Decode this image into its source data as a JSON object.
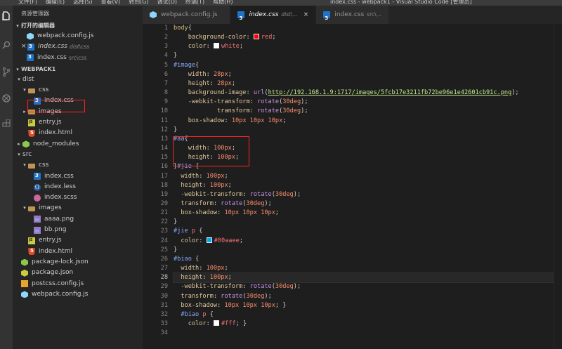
{
  "window": {
    "menu": [
      "文件(F)",
      "编辑(E)",
      "选择(S)",
      "查看(V)",
      "转到(G)",
      "调试(D)",
      "终端(T)",
      "帮助(H)"
    ],
    "title": "index.css - webpack1 - Visual Studio Code [管理员]"
  },
  "sidebar": {
    "title": "资源管理器",
    "open_editors_label": "打开的编辑器",
    "open_editors": [
      {
        "name": "webpack.config.js",
        "desc": "",
        "icon": "webpack-icon"
      },
      {
        "name": "index.css",
        "desc": "dist\\css",
        "icon": "css-icon",
        "close": "×"
      },
      {
        "name": "index.css",
        "desc": "src\\css",
        "icon": "css-icon"
      }
    ],
    "project_label": "WEBPACK1",
    "tree": [
      {
        "name": "dist",
        "arrow": "▾"
      },
      {
        "name": "css",
        "arrow": "▾"
      },
      {
        "name": "index.css"
      },
      {
        "name": "images",
        "arrow": "▸"
      },
      {
        "name": "entry.js"
      },
      {
        "name": "index.html"
      },
      {
        "name": "node_modules",
        "arrow": "▸"
      },
      {
        "name": "src",
        "arrow": "▾"
      },
      {
        "name": "css",
        "arrow": "▾"
      },
      {
        "name": "index.css"
      },
      {
        "name": "index.less"
      },
      {
        "name": "index.scss"
      },
      {
        "name": "images",
        "arrow": "▾"
      },
      {
        "name": "aaaa.png"
      },
      {
        "name": "bb.png"
      },
      {
        "name": "entry.js"
      },
      {
        "name": "index.html"
      },
      {
        "name": "package-lock.json"
      },
      {
        "name": "package.json"
      },
      {
        "name": "postcss.config.js"
      },
      {
        "name": "webpack.config.js"
      }
    ]
  },
  "tabs": [
    {
      "label": "webpack.config.js",
      "desc": "",
      "close": ""
    },
    {
      "label": "index.css",
      "desc": "dist\\...",
      "close": "×"
    },
    {
      "label": "index.css",
      "desc": "src\\..."
    }
  ],
  "editor": {
    "current_line": 28,
    "colors": {
      "red_swatch": "#ff0000",
      "white_swatch": "#ffffff",
      "teal_swatch": "#00aaee",
      "fff_swatch": "#ffffff"
    },
    "lines": [
      {
        "n": "1",
        "t": [
          [
            "t-sel",
            "body"
          ],
          [
            "t-punc",
            "{"
          ]
        ]
      },
      {
        "n": "2",
        "t": [
          [
            "t-punc",
            "    "
          ],
          [
            "t-prop",
            "background-color"
          ],
          [
            "t-punc",
            ": "
          ],
          [
            "sw",
            "#ff0000"
          ],
          [
            "t-val",
            "red"
          ],
          [
            "t-punc",
            ";"
          ]
        ]
      },
      {
        "n": "3",
        "t": [
          [
            "t-punc",
            "    "
          ],
          [
            "t-prop",
            "color"
          ],
          [
            "t-punc",
            ": "
          ],
          [
            "sw",
            "#ffffff"
          ],
          [
            "t-val",
            "white"
          ],
          [
            "t-punc",
            ";"
          ]
        ]
      },
      {
        "n": "4",
        "t": [
          [
            "t-punc",
            "}"
          ]
        ]
      },
      {
        "n": "5",
        "t": [
          [
            "sel-id",
            "#image"
          ],
          [
            "t-punc",
            "{"
          ]
        ]
      },
      {
        "n": "6",
        "t": [
          [
            "t-punc",
            "    "
          ],
          [
            "t-prop",
            "width"
          ],
          [
            "t-punc",
            ": "
          ],
          [
            "t-num",
            "28px"
          ],
          [
            "t-punc",
            ";"
          ]
        ]
      },
      {
        "n": "7",
        "t": [
          [
            "t-punc",
            "    "
          ],
          [
            "t-prop",
            "height"
          ],
          [
            "t-punc",
            ": "
          ],
          [
            "t-num",
            "28px"
          ],
          [
            "t-punc",
            ";"
          ]
        ]
      },
      {
        "n": "8",
        "t": [
          [
            "t-punc",
            "    "
          ],
          [
            "t-prop",
            "background-image"
          ],
          [
            "t-punc",
            ": "
          ],
          [
            "t-fn",
            "url"
          ],
          [
            "t-punc",
            "("
          ],
          [
            "t-url",
            "http://192.168.1.9:1717/images/5fcb17e3211fb72be96e1e42601cb91c.png"
          ],
          [
            "t-punc",
            ");"
          ]
        ]
      },
      {
        "n": "9",
        "t": [
          [
            "t-punc",
            "    "
          ],
          [
            "t-prop",
            "-webkit-transform"
          ],
          [
            "t-punc",
            ": "
          ],
          [
            "t-fn",
            "rotate"
          ],
          [
            "t-punc",
            "("
          ],
          [
            "t-num",
            "30deg"
          ],
          [
            "t-punc",
            ");"
          ]
        ]
      },
      {
        "n": "10",
        "t": [
          [
            "t-punc",
            "            "
          ],
          [
            "t-prop",
            "transform"
          ],
          [
            "t-punc",
            ": "
          ],
          [
            "t-fn",
            "rotate"
          ],
          [
            "t-punc",
            "("
          ],
          [
            "t-num",
            "30deg"
          ],
          [
            "t-punc",
            ");"
          ]
        ]
      },
      {
        "n": "11",
        "t": [
          [
            "t-punc",
            "    "
          ],
          [
            "t-prop",
            "box-shadow"
          ],
          [
            "t-punc",
            ": "
          ],
          [
            "t-num",
            "10px 10px 10px"
          ],
          [
            "t-punc",
            ";"
          ]
        ]
      },
      {
        "n": "12",
        "t": [
          [
            "t-punc",
            "}"
          ]
        ]
      },
      {
        "n": "13",
        "t": [
          [
            "sel-id",
            "#aa"
          ],
          [
            "t-punc",
            "{"
          ]
        ]
      },
      {
        "n": "14",
        "t": [
          [
            "t-punc",
            "    "
          ],
          [
            "t-prop",
            "width"
          ],
          [
            "t-punc",
            ": "
          ],
          [
            "t-num",
            "100px"
          ],
          [
            "t-punc",
            ";"
          ]
        ]
      },
      {
        "n": "15",
        "t": [
          [
            "t-punc",
            "    "
          ],
          [
            "t-prop",
            "height"
          ],
          [
            "t-punc",
            ": "
          ],
          [
            "t-num",
            "100px"
          ],
          [
            "t-punc",
            ";"
          ]
        ]
      },
      {
        "n": "16",
        "t": [
          [
            "t-punc",
            "}"
          ],
          [
            "sel-id",
            "#jie"
          ],
          [
            "t-punc",
            " {"
          ]
        ]
      },
      {
        "n": "17",
        "t": [
          [
            "t-punc",
            "  "
          ],
          [
            "t-prop",
            "width"
          ],
          [
            "t-punc",
            ": "
          ],
          [
            "t-num",
            "100px"
          ],
          [
            "t-punc",
            ";"
          ]
        ]
      },
      {
        "n": "18",
        "t": [
          [
            "t-punc",
            "  "
          ],
          [
            "t-prop",
            "height"
          ],
          [
            "t-punc",
            ": "
          ],
          [
            "t-num",
            "100px"
          ],
          [
            "t-punc",
            ";"
          ]
        ]
      },
      {
        "n": "19",
        "t": [
          [
            "t-punc",
            "  "
          ],
          [
            "t-prop",
            "-webkit-transform"
          ],
          [
            "t-punc",
            ": "
          ],
          [
            "t-fn",
            "rotate"
          ],
          [
            "t-punc",
            "("
          ],
          [
            "t-num",
            "30deg"
          ],
          [
            "t-punc",
            ");"
          ]
        ]
      },
      {
        "n": "20",
        "t": [
          [
            "t-punc",
            "  "
          ],
          [
            "t-prop",
            "transform"
          ],
          [
            "t-punc",
            ": "
          ],
          [
            "t-fn",
            "rotate"
          ],
          [
            "t-punc",
            "("
          ],
          [
            "t-num",
            "30deg"
          ],
          [
            "t-punc",
            ");"
          ]
        ]
      },
      {
        "n": "21",
        "t": [
          [
            "t-punc",
            "  "
          ],
          [
            "t-prop",
            "box-shadow"
          ],
          [
            "t-punc",
            ": "
          ],
          [
            "t-num",
            "10px 10px 10px"
          ],
          [
            "t-punc",
            ";"
          ]
        ]
      },
      {
        "n": "22",
        "t": [
          [
            "t-punc",
            "}"
          ]
        ]
      },
      {
        "n": "23",
        "t": [
          [
            "sel-id",
            "#jie"
          ],
          [
            "t-punc",
            " "
          ],
          [
            "t-tag",
            "p"
          ],
          [
            "t-punc",
            " {"
          ]
        ]
      },
      {
        "n": "24",
        "t": [
          [
            "t-punc",
            "  "
          ],
          [
            "t-prop",
            "color"
          ],
          [
            "t-punc",
            ": "
          ],
          [
            "sw",
            "#00aaee"
          ],
          [
            "t-val",
            "#00aaee"
          ],
          [
            "t-punc",
            ";"
          ]
        ]
      },
      {
        "n": "25",
        "t": [
          [
            "t-punc",
            "}"
          ]
        ]
      },
      {
        "n": "26",
        "t": [
          [
            "sel-id",
            "#biao"
          ],
          [
            "t-punc",
            " {"
          ]
        ]
      },
      {
        "n": "27",
        "t": [
          [
            "t-punc",
            "  "
          ],
          [
            "t-prop",
            "width"
          ],
          [
            "t-punc",
            ": "
          ],
          [
            "t-num",
            "100px"
          ],
          [
            "t-punc",
            ";"
          ]
        ]
      },
      {
        "n": "28",
        "t": [
          [
            "t-punc",
            "  "
          ],
          [
            "t-prop",
            "height"
          ],
          [
            "t-punc",
            ": "
          ],
          [
            "t-num",
            "100px"
          ],
          [
            "t-punc",
            ";"
          ]
        ]
      },
      {
        "n": "29",
        "t": [
          [
            "t-punc",
            "  "
          ],
          [
            "t-prop",
            "-webkit-transform"
          ],
          [
            "t-punc",
            ": "
          ],
          [
            "t-fn",
            "rotate"
          ],
          [
            "t-punc",
            "("
          ],
          [
            "t-num",
            "30deg"
          ],
          [
            "t-punc",
            ");"
          ]
        ]
      },
      {
        "n": "30",
        "t": [
          [
            "t-punc",
            "  "
          ],
          [
            "t-prop",
            "transform"
          ],
          [
            "t-punc",
            ": "
          ],
          [
            "t-fn",
            "rotate"
          ],
          [
            "t-punc",
            "("
          ],
          [
            "t-num",
            "30deg"
          ],
          [
            "t-punc",
            ");"
          ]
        ]
      },
      {
        "n": "31",
        "t": [
          [
            "t-punc",
            "  "
          ],
          [
            "t-prop",
            "box-shadow"
          ],
          [
            "t-punc",
            ": "
          ],
          [
            "t-num",
            "10px 10px 10px"
          ],
          [
            "t-punc",
            "; }"
          ]
        ]
      },
      {
        "n": "32",
        "t": [
          [
            "t-punc",
            "  "
          ],
          [
            "sel-id",
            "#biao"
          ],
          [
            "t-punc",
            " "
          ],
          [
            "t-tag",
            "p"
          ],
          [
            "t-punc",
            " {"
          ]
        ]
      },
      {
        "n": "33",
        "t": [
          [
            "t-punc",
            "    "
          ],
          [
            "t-prop",
            "color"
          ],
          [
            "t-punc",
            ": "
          ],
          [
            "sw",
            "#ffffff"
          ],
          [
            "t-val",
            "#fff"
          ],
          [
            "t-punc",
            "; }"
          ]
        ]
      },
      {
        "n": "34",
        "t": []
      }
    ]
  }
}
